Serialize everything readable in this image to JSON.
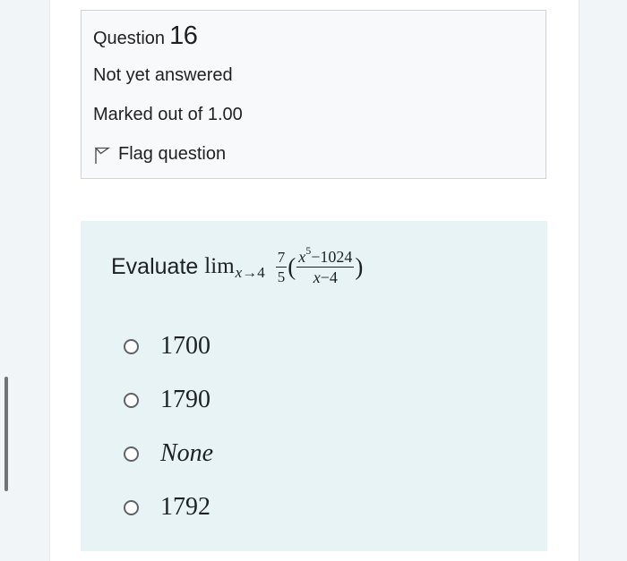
{
  "info": {
    "question_word": "Question",
    "question_number": "16",
    "state": "Not yet answered",
    "grade": "Marked out of 1.00",
    "flag_label": "Flag question"
  },
  "question": {
    "prefix": "Evaluate",
    "lim": "lim",
    "lim_var": "x",
    "lim_arrow": "→",
    "lim_target": "4",
    "coef_num": "7",
    "coef_den": "5",
    "open_paren": "(",
    "close_paren": ")",
    "num_base": "x",
    "num_exp": "5",
    "num_rest": "−1024",
    "den_var": "x",
    "den_rest": "−4"
  },
  "answers": [
    {
      "label": "1700",
      "italic": false
    },
    {
      "label": "1790",
      "italic": false
    },
    {
      "label": "None",
      "italic": true
    },
    {
      "label": "1792",
      "italic": false
    }
  ],
  "icons": {
    "flag": "flag-icon",
    "radio": "radio-button"
  },
  "colors": {
    "page_background": "#f2f5f7",
    "info_background": "#f8f9fa",
    "info_border": "#cfd4d8",
    "content_background": "#e7f3f5",
    "text": "#1d2125",
    "scroll_indicator": "#6f7478"
  }
}
